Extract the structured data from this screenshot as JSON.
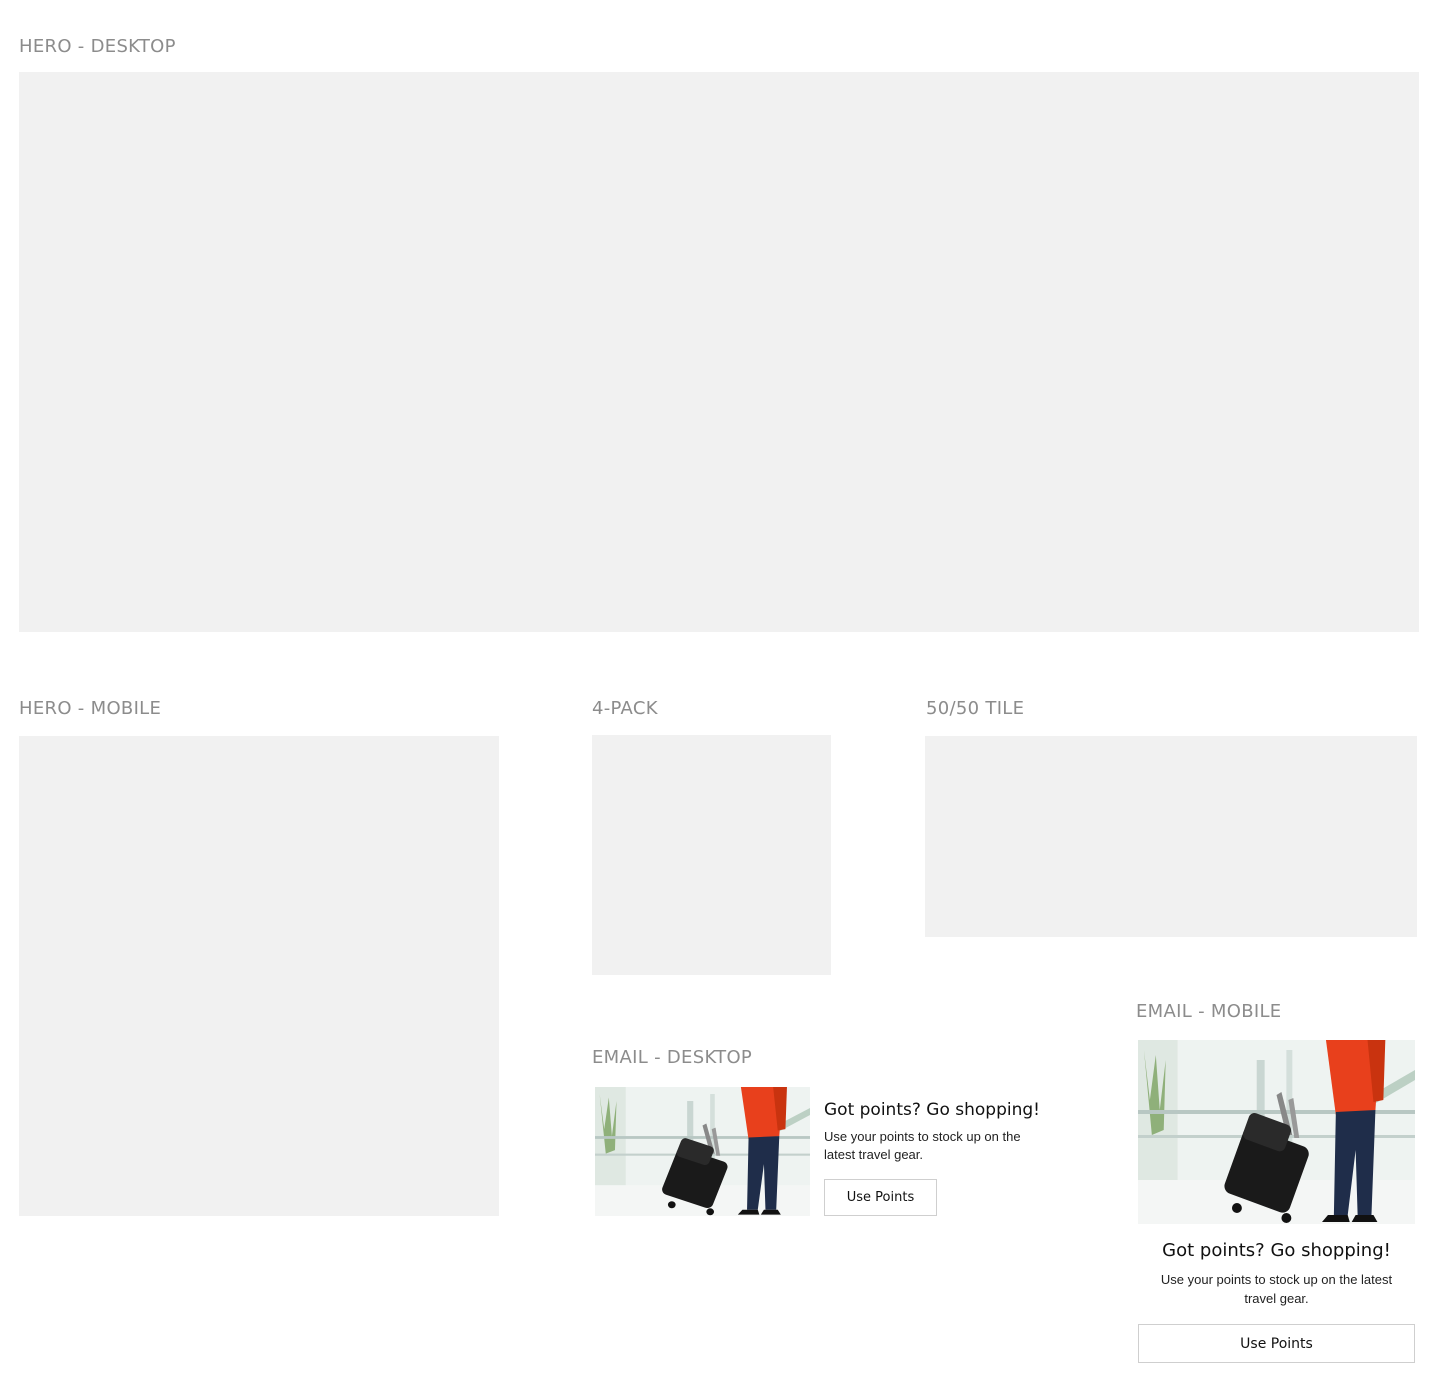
{
  "sections": {
    "hero_desktop": {
      "label": "HERO - DESKTOP"
    },
    "hero_mobile": {
      "label": "HERO - MOBILE"
    },
    "four_pack": {
      "label": "4-PACK"
    },
    "fifty_fifty_tile": {
      "label": "50/50 TILE"
    },
    "email_desktop": {
      "label": "EMAIL - DESKTOP",
      "title": "Got points? Go shopping!",
      "body_line1": "Use your points to stock up on the",
      "body_line2": "latest travel gear.",
      "button_label": "Use Points"
    },
    "email_mobile": {
      "label": "EMAIL - MOBILE",
      "title": "Got points? Go shopping!",
      "body_line1": "Use your points to stock up on the latest",
      "body_line2": "travel gear.",
      "button_label": "Use Points"
    }
  },
  "colors": {
    "placeholder": "#f1f1f1",
    "label": "#8c8c8c",
    "jacket": "#e8401c",
    "jeans": "#1f2d4a",
    "luggage": "#1a1a1a"
  }
}
